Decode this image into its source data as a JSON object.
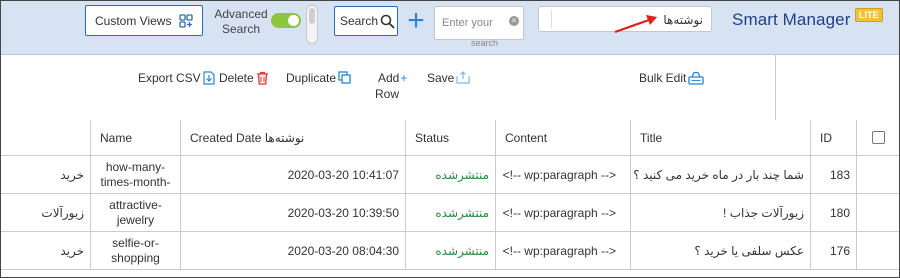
{
  "header": {
    "custom_views_label": "Custom Views",
    "advanced_search_label": "Advanced Search",
    "search_button_label": "Search",
    "search_placeholder": "Enter your",
    "search_sub_label": "search",
    "post_type_value": "نوشته‌ها",
    "brand": "Smart Manager",
    "badge": "LITE",
    "toggle_on": true
  },
  "toolbar": {
    "export_csv": "Export CSV",
    "delete": "Delete",
    "duplicate": "Duplicate",
    "add_row_line1": "Add",
    "add_row_line2": "Row",
    "save": "Save",
    "bulk_edit": "Bulk Edit"
  },
  "table": {
    "columns": {
      "blank": "",
      "name": "Name",
      "created_date": "Created Date نوشته‌ها",
      "status": "Status",
      "content": "Content",
      "title": "Title",
      "id": "ID"
    },
    "rows": [
      {
        "cat": "خرید",
        "name": "how-many-times-month-",
        "date": "2020-03-20 10:41:07",
        "status": "منتشرشده",
        "content": "<!-- wp:paragraph -->",
        "title": "شما چند بار در ماه خرید می کنید ؟",
        "id": "183"
      },
      {
        "cat": "زیورآلات",
        "name": "attractive-jewelry",
        "date": "2020-03-20 10:39:50",
        "status": "منتشرشده",
        "content": "<!-- wp:paragraph -->",
        "title": "زیورآلات جذاب !",
        "id": "180"
      },
      {
        "cat": "خرید",
        "name": "selfie-or-shopping",
        "date": "2020-03-20 08:04:30",
        "status": "منتشرشده",
        "content": "<!-- wp:paragraph -->",
        "title": "عکس سلفی یا خرید ؟",
        "id": "176"
      }
    ]
  },
  "colors": {
    "header_bg": "#d7e2f2",
    "accent": "#2b6cb0",
    "status_published": "#2b8a3e",
    "arrow": "#e0201a",
    "badge": "#f1c232"
  }
}
